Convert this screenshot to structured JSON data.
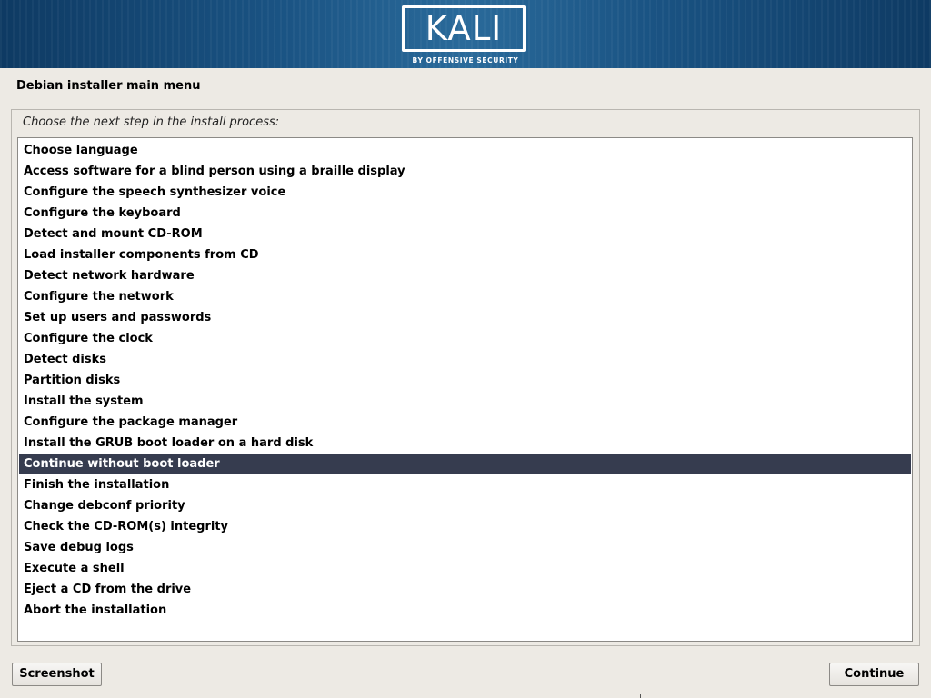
{
  "banner": {
    "logo_text": "KALI",
    "logo_tagline": "BY OFFENSIVE SECURITY"
  },
  "page_title": "Debian installer main menu",
  "prompt": "Choose the next step in the install process:",
  "menu": {
    "selected_index": 15,
    "items": [
      "Choose language",
      "Access software for a blind person using a braille display",
      "Configure the speech synthesizer voice",
      "Configure the keyboard",
      "Detect and mount CD-ROM",
      "Load installer components from CD",
      "Detect network hardware",
      "Configure the network",
      "Set up users and passwords",
      "Configure the clock",
      "Detect disks",
      "Partition disks",
      "Install the system",
      "Configure the package manager",
      "Install the GRUB boot loader on a hard disk",
      "Continue without boot loader",
      "Finish the installation",
      "Change debconf priority",
      "Check the CD-ROM(s) integrity",
      "Save debug logs",
      "Execute a shell",
      "Eject a CD from the drive",
      "Abort the installation"
    ]
  },
  "buttons": {
    "screenshot": "Screenshot",
    "continue": "Continue"
  },
  "colors": {
    "banner": "#1a5383",
    "selected_row": "#363c4f",
    "background": "#edeae4"
  }
}
